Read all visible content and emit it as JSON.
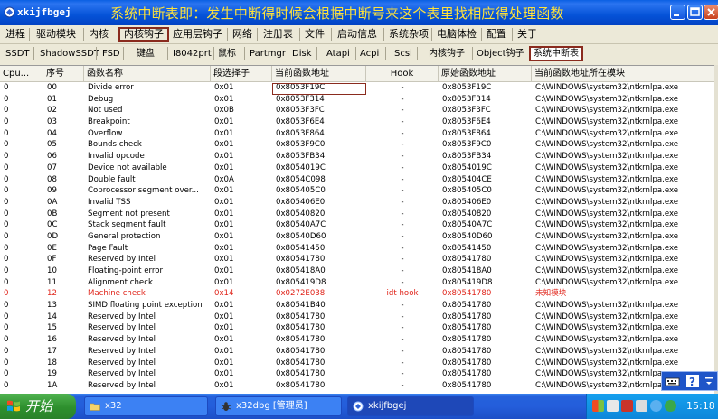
{
  "window": {
    "app_title": "xkijfbgej",
    "banner": "系统中断表即：发生中断得时候会根据中断号来这个表里找相应得处理函数"
  },
  "menu": [
    "进程",
    "驱动模块",
    "内核",
    "内核钩子",
    "应用层钩子",
    "网络",
    "注册表",
    "文件",
    "启动信息",
    "系统杂项",
    "电脑体检",
    "配置",
    "关于"
  ],
  "subtabs": [
    "SSDT",
    "ShadowSSDT",
    "FSD",
    "键盘",
    "I8042prt",
    "鼠标",
    "Partmgr",
    "Disk",
    "Atapi",
    "Acpi",
    "Scsi",
    "内核钩子",
    "Object钩子",
    "系统中断表"
  ],
  "table": {
    "columns": [
      "Cpu...",
      "序号",
      "函数名称",
      "段选择子",
      "当前函数地址",
      "Hook",
      "原始函数地址",
      "当前函数地址所在模块"
    ],
    "rows": [
      [
        "0",
        "00",
        "Divide error",
        "0x01",
        "0x8053F19C",
        "-",
        "0x8053F19C",
        "C:\\WINDOWS\\system32\\ntkrnlpa.exe"
      ],
      [
        "0",
        "01",
        "Debug",
        "0x01",
        "0x8053F314",
        "-",
        "0x8053F314",
        "C:\\WINDOWS\\system32\\ntkrnlpa.exe"
      ],
      [
        "0",
        "02",
        "Not used",
        "0x0B",
        "0x8053F3FC",
        "-",
        "0x8053F3FC",
        "C:\\WINDOWS\\system32\\ntkrnlpa.exe"
      ],
      [
        "0",
        "03",
        "Breakpoint",
        "0x01",
        "0x8053F6E4",
        "-",
        "0x8053F6E4",
        "C:\\WINDOWS\\system32\\ntkrnlpa.exe"
      ],
      [
        "0",
        "04",
        "Overflow",
        "0x01",
        "0x8053F864",
        "-",
        "0x8053F864",
        "C:\\WINDOWS\\system32\\ntkrnlpa.exe"
      ],
      [
        "0",
        "05",
        "Bounds check",
        "0x01",
        "0x8053F9C0",
        "-",
        "0x8053F9C0",
        "C:\\WINDOWS\\system32\\ntkrnlpa.exe"
      ],
      [
        "0",
        "06",
        "Invalid opcode",
        "0x01",
        "0x8053FB34",
        "-",
        "0x8053FB34",
        "C:\\WINDOWS\\system32\\ntkrnlpa.exe"
      ],
      [
        "0",
        "07",
        "Device not available",
        "0x01",
        "0x8054019C",
        "-",
        "0x8054019C",
        "C:\\WINDOWS\\system32\\ntkrnlpa.exe"
      ],
      [
        "0",
        "08",
        "Double fault",
        "0x0A",
        "0x8054C098",
        "-",
        "0x805404CE",
        "C:\\WINDOWS\\system32\\ntkrnlpa.exe"
      ],
      [
        "0",
        "09",
        "Coprocessor segment over...",
        "0x01",
        "0x805405C0",
        "-",
        "0x805405C0",
        "C:\\WINDOWS\\system32\\ntkrnlpa.exe"
      ],
      [
        "0",
        "0A",
        "Invalid TSS",
        "0x01",
        "0x805406E0",
        "-",
        "0x805406E0",
        "C:\\WINDOWS\\system32\\ntkrnlpa.exe"
      ],
      [
        "0",
        "0B",
        "Segment not present",
        "0x01",
        "0x80540820",
        "-",
        "0x80540820",
        "C:\\WINDOWS\\system32\\ntkrnlpa.exe"
      ],
      [
        "0",
        "0C",
        "Stack segment fault",
        "0x01",
        "0x80540A7C",
        "-",
        "0x80540A7C",
        "C:\\WINDOWS\\system32\\ntkrnlpa.exe"
      ],
      [
        "0",
        "0D",
        "General protection",
        "0x01",
        "0x80540D60",
        "-",
        "0x80540D60",
        "C:\\WINDOWS\\system32\\ntkrnlpa.exe"
      ],
      [
        "0",
        "0E",
        "Page Fault",
        "0x01",
        "0x80541450",
        "-",
        "0x80541450",
        "C:\\WINDOWS\\system32\\ntkrnlpa.exe"
      ],
      [
        "0",
        "0F",
        "Reserved by Intel",
        "0x01",
        "0x80541780",
        "-",
        "0x80541780",
        "C:\\WINDOWS\\system32\\ntkrnlpa.exe"
      ],
      [
        "0",
        "10",
        "Floating-point error",
        "0x01",
        "0x805418A0",
        "-",
        "0x805418A0",
        "C:\\WINDOWS\\system32\\ntkrnlpa.exe"
      ],
      [
        "0",
        "11",
        "Alignment check",
        "0x01",
        "0x805419D8",
        "-",
        "0x805419D8",
        "C:\\WINDOWS\\system32\\ntkrnlpa.exe"
      ],
      [
        "0",
        "12",
        "Machine check",
        "0x14",
        "0x0272E038",
        "idt hook",
        "0x80541780",
        "未知模块"
      ],
      [
        "0",
        "13",
        "SIMD floating point exception",
        "0x01",
        "0x80541B40",
        "-",
        "0x80541780",
        "C:\\WINDOWS\\system32\\ntkrnlpa.exe"
      ],
      [
        "0",
        "14",
        "Reserved by Intel",
        "0x01",
        "0x80541780",
        "-",
        "0x80541780",
        "C:\\WINDOWS\\system32\\ntkrnlpa.exe"
      ],
      [
        "0",
        "15",
        "Reserved by Intel",
        "0x01",
        "0x80541780",
        "-",
        "0x80541780",
        "C:\\WINDOWS\\system32\\ntkrnlpa.exe"
      ],
      [
        "0",
        "16",
        "Reserved by Intel",
        "0x01",
        "0x80541780",
        "-",
        "0x80541780",
        "C:\\WINDOWS\\system32\\ntkrnlpa.exe"
      ],
      [
        "0",
        "17",
        "Reserved by Intel",
        "0x01",
        "0x80541780",
        "-",
        "0x80541780",
        "C:\\WINDOWS\\system32\\ntkrnlpa.exe"
      ],
      [
        "0",
        "18",
        "Reserved by Intel",
        "0x01",
        "0x80541780",
        "-",
        "0x80541780",
        "C:\\WINDOWS\\system32\\ntkrnlpa.exe"
      ],
      [
        "0",
        "19",
        "Reserved by Intel",
        "0x01",
        "0x80541780",
        "-",
        "0x80541780",
        "C:\\WINDOWS\\system32\\ntkrnlpa.exe"
      ],
      [
        "0",
        "1A",
        "Reserved by Intel",
        "0x01",
        "0x80541780",
        "-",
        "0x80541780",
        "C:\\WINDOWS\\system32\\ntkrnlpa.exe"
      ]
    ],
    "hooked_row_index": 18,
    "hooked_color": "#e0251b",
    "selected_row_index": 0
  },
  "taskbar": {
    "start_label": "开始",
    "tasks": [
      "x32",
      "x32dbg [管理员]",
      "xkijfbgej"
    ],
    "active_task_index": 2,
    "clock": "15:18"
  },
  "icons": {
    "app": "shield-icon",
    "window_buttons": [
      "minimize-icon",
      "maximize-icon",
      "close-icon"
    ],
    "task_icons": [
      "folder-icon",
      "bug-icon",
      "app-icon"
    ]
  }
}
